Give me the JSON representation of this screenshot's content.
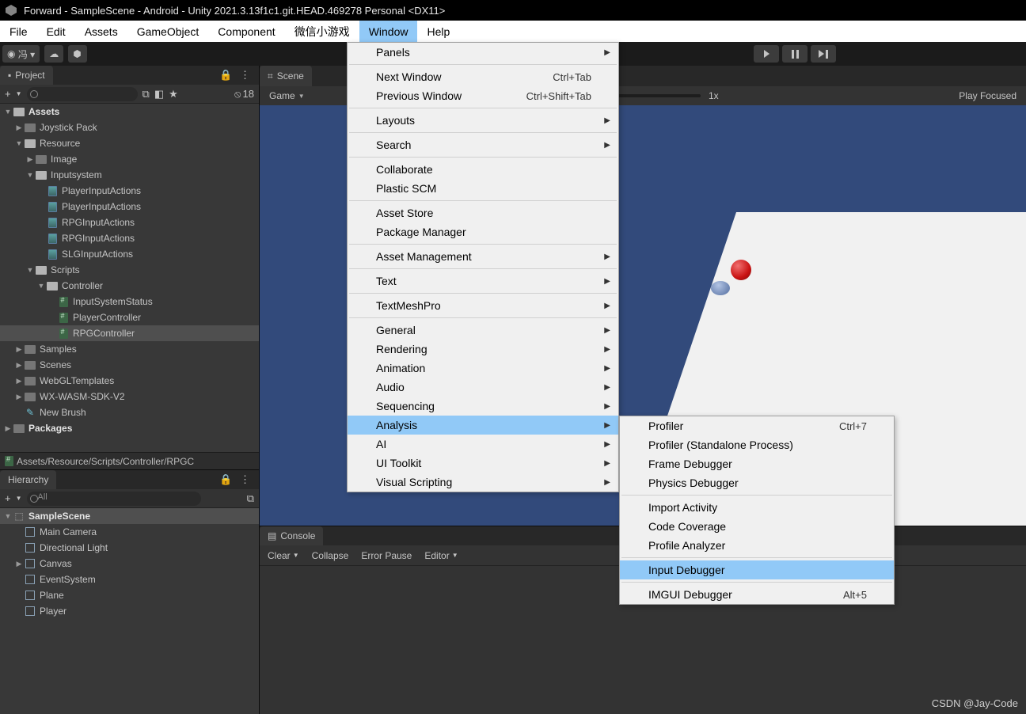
{
  "titlebar": "Forward - SampleScene - Android - Unity 2021.3.13f1c1.git.HEAD.469278 Personal <DX11>",
  "menubar": [
    "File",
    "Edit",
    "Assets",
    "GameObject",
    "Component",
    "微信小游戏",
    "Window",
    "Help"
  ],
  "menubar_active": 6,
  "toolbar": {
    "account": "冯 ▾",
    "layers_count": "18"
  },
  "project": {
    "tab": "Project",
    "filter_plus": "+",
    "filter_star": "★",
    "tree": [
      {
        "d": 0,
        "f": "down",
        "t": "folder-open",
        "label": "Assets",
        "bold": true
      },
      {
        "d": 1,
        "f": "right",
        "t": "folder",
        "label": "Joystick Pack"
      },
      {
        "d": 1,
        "f": "down",
        "t": "folder-open",
        "label": "Resource"
      },
      {
        "d": 2,
        "f": "right",
        "t": "folder",
        "label": "Image"
      },
      {
        "d": 2,
        "f": "down",
        "t": "folder-open",
        "label": "Inputsystem"
      },
      {
        "d": 3,
        "f": "",
        "t": "act",
        "label": "PlayerInputActions"
      },
      {
        "d": 3,
        "f": "",
        "t": "act",
        "label": "PlayerInputActions"
      },
      {
        "d": 3,
        "f": "",
        "t": "act",
        "label": "RPGInputActions"
      },
      {
        "d": 3,
        "f": "",
        "t": "act",
        "label": "RPGInputActions"
      },
      {
        "d": 3,
        "f": "",
        "t": "act",
        "label": "SLGInputActions"
      },
      {
        "d": 2,
        "f": "down",
        "t": "folder-open",
        "label": "Scripts"
      },
      {
        "d": 3,
        "f": "down",
        "t": "folder-open",
        "label": "Controller"
      },
      {
        "d": 4,
        "f": "",
        "t": "cs",
        "label": "InputSystemStatus"
      },
      {
        "d": 4,
        "f": "",
        "t": "cs",
        "label": "PlayerController"
      },
      {
        "d": 4,
        "f": "",
        "t": "cs",
        "label": "RPGController",
        "sel": true
      },
      {
        "d": 1,
        "f": "right",
        "t": "folder",
        "label": "Samples"
      },
      {
        "d": 1,
        "f": "right",
        "t": "folder",
        "label": "Scenes"
      },
      {
        "d": 1,
        "f": "right",
        "t": "folder",
        "label": "WebGLTemplates"
      },
      {
        "d": 1,
        "f": "right",
        "t": "folder",
        "label": "WX-WASM-SDK-V2"
      },
      {
        "d": 1,
        "f": "",
        "t": "brush",
        "label": "New Brush"
      },
      {
        "d": 0,
        "f": "right",
        "t": "folder",
        "label": "Packages",
        "bold": true
      }
    ],
    "crumb": "Assets/Resource/Scripts/Controller/RPGC"
  },
  "hierarchy": {
    "tab": "Hierarchy",
    "search_placeholder": "All",
    "items": [
      {
        "d": 0,
        "f": "down",
        "t": "scene",
        "label": "SampleScene",
        "bold": true,
        "sel": true
      },
      {
        "d": 1,
        "f": "",
        "t": "go",
        "label": "Main Camera"
      },
      {
        "d": 1,
        "f": "",
        "t": "go",
        "label": "Directional Light"
      },
      {
        "d": 1,
        "f": "right",
        "t": "go",
        "label": "Canvas"
      },
      {
        "d": 1,
        "f": "",
        "t": "go",
        "label": "EventSystem"
      },
      {
        "d": 1,
        "f": "",
        "t": "go",
        "label": "Plane"
      },
      {
        "d": 1,
        "f": "",
        "t": "go",
        "label": "Player"
      }
    ]
  },
  "scene_tab": "Scene",
  "game": {
    "dropdown": "Game",
    "aspect": "e",
    "scale_label": "1x",
    "right_label": "Play Focused"
  },
  "console": {
    "tab": "Console",
    "tools": [
      "Clear",
      "Collapse",
      "Error Pause",
      "Editor"
    ]
  },
  "window_menu": [
    {
      "l": "Panels",
      "sub": true,
      "sep": true
    },
    {
      "l": "Next Window",
      "k": "Ctrl+Tab"
    },
    {
      "l": "Previous Window",
      "k": "Ctrl+Shift+Tab",
      "sep": true
    },
    {
      "l": "Layouts",
      "sub": true,
      "sep": true
    },
    {
      "l": "Search",
      "sub": true,
      "sep": true
    },
    {
      "l": "Collaborate"
    },
    {
      "l": "Plastic SCM",
      "sep": true
    },
    {
      "l": "Asset Store"
    },
    {
      "l": "Package Manager",
      "sep": true
    },
    {
      "l": "Asset Management",
      "sub": true,
      "sep": true
    },
    {
      "l": "Text",
      "sub": true,
      "sep": true
    },
    {
      "l": "TextMeshPro",
      "sub": true,
      "sep": true
    },
    {
      "l": "General",
      "sub": true
    },
    {
      "l": "Rendering",
      "sub": true
    },
    {
      "l": "Animation",
      "sub": true
    },
    {
      "l": "Audio",
      "sub": true
    },
    {
      "l": "Sequencing",
      "sub": true
    },
    {
      "l": "Analysis",
      "sub": true,
      "hl": true
    },
    {
      "l": "AI",
      "sub": true
    },
    {
      "l": "UI Toolkit",
      "sub": true
    },
    {
      "l": "Visual Scripting",
      "sub": true
    }
  ],
  "analysis_menu": [
    {
      "l": "Profiler",
      "k": "Ctrl+7"
    },
    {
      "l": "Profiler (Standalone Process)"
    },
    {
      "l": "Frame Debugger"
    },
    {
      "l": "Physics Debugger",
      "sep": true
    },
    {
      "l": "Import Activity"
    },
    {
      "l": "Code Coverage"
    },
    {
      "l": "Profile Analyzer",
      "sep": true
    },
    {
      "l": "Input Debugger",
      "hl": true,
      "sep": true
    },
    {
      "l": "IMGUI Debugger",
      "k": "Alt+5"
    }
  ],
  "watermark": "CSDN @Jay-Code"
}
